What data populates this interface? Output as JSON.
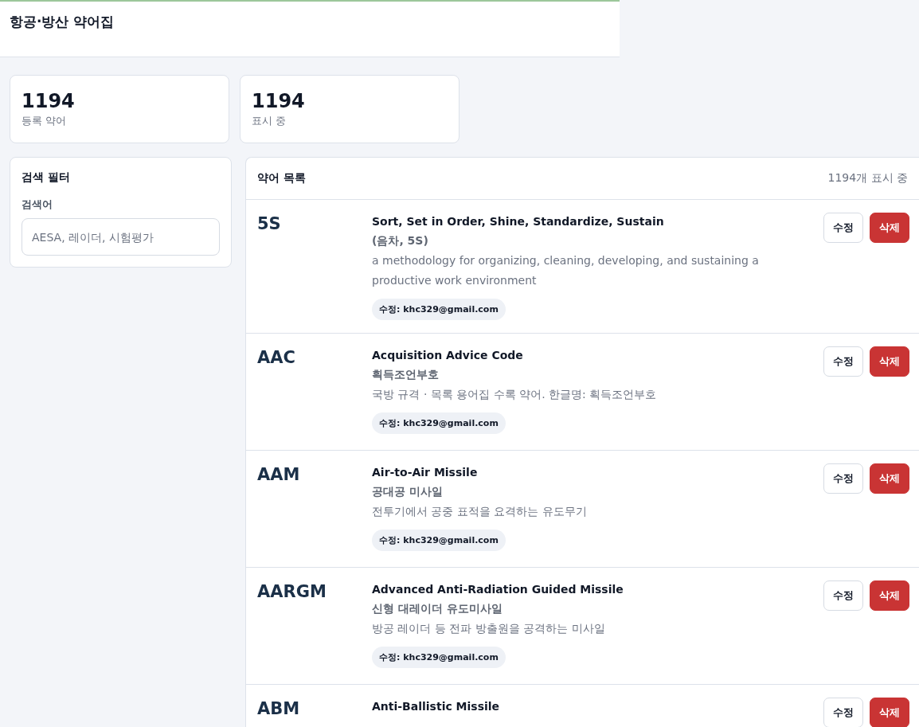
{
  "header": {
    "title": "항공·방산 약어집"
  },
  "stats": [
    {
      "value": "1194",
      "label": "등록 약어"
    },
    {
      "value": "1194",
      "label": "표시 중"
    }
  ],
  "filter": {
    "title": "검색 필터",
    "search_label": "검색어",
    "placeholder": "AESA, 레이더, 시험평가"
  },
  "list": {
    "title": "약어 목록",
    "count": "1194개 표시 중",
    "entries": [
      {
        "abbr": "5S",
        "english": "Sort, Set in Order, Shine, Standardize, Sustain",
        "korean": "(음차, 5S)",
        "description": "a methodology for organizing, cleaning, developing, and sustaining a productive work environment",
        "editor": "수정: khc329@gmail.com",
        "edit": "수정",
        "delete": "삭제"
      },
      {
        "abbr": "AAC",
        "english": "Acquisition Advice Code",
        "korean": "획득조언부호",
        "description": "국방 규격 · 목록 용어집 수록 약어. 한글명: 획득조언부호",
        "editor": "수정: khc329@gmail.com",
        "edit": "수정",
        "delete": "삭제"
      },
      {
        "abbr": "AAM",
        "english": "Air-to-Air Missile",
        "korean": "공대공 미사일",
        "description": "전투기에서 공중 표적을 요격하는 유도무기",
        "editor": "수정: khc329@gmail.com",
        "edit": "수정",
        "delete": "삭제"
      },
      {
        "abbr": "AARGM",
        "english": "Advanced Anti-Radiation Guided Missile",
        "korean": "신형 대레이더 유도미사일",
        "description": "방공 레이더 등 전파 방출원을 공격하는 미사일",
        "editor": "수정: khc329@gmail.com",
        "edit": "수정",
        "delete": "삭제"
      },
      {
        "abbr": "ABM",
        "english": "Anti-Ballistic Missile",
        "edit": "수정",
        "delete": "삭제"
      }
    ]
  }
}
